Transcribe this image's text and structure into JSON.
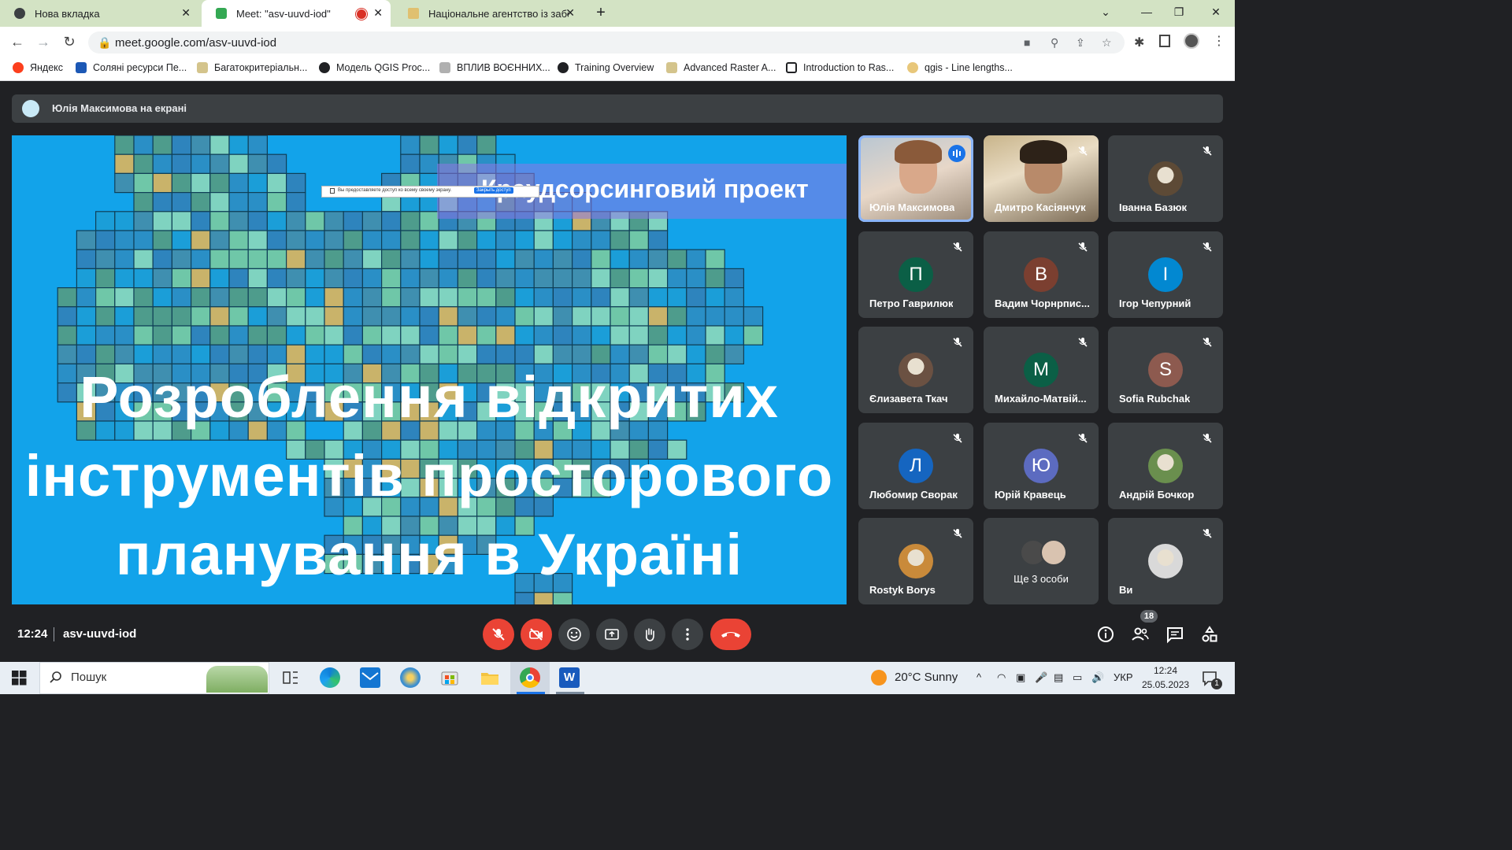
{
  "browser": {
    "tabs": [
      {
        "label": "Нова вкладка",
        "active": false
      },
      {
        "label": "Meet: \"asv-uuvd-iod\"",
        "active": true
      },
      {
        "label": "Національне агентство із забезп",
        "active": false
      }
    ],
    "url": "meet.google.com/asv-uuvd-iod",
    "bookmarks": [
      "Яндекс",
      "Соляні ресурси Пе...",
      "Багатокритеріальн...",
      "Модель QGIS Proc...",
      "ВПЛИВ ВОЄННИХ...",
      "Training Overview",
      "Advanced Raster A...",
      "Introduction to Ras...",
      "qgis - Line lengths..."
    ]
  },
  "meet": {
    "presenter_banner": "Юлія Максимова на екрані",
    "slide": {
      "subtitle": "Краудсорсинговий проект",
      "title_lines": [
        "Розроблення відкритих",
        "інструментів просторового",
        "планування в Україні"
      ],
      "share_popup_text": "Вы предоставляете доступ ко всему своему экрану.",
      "share_popup_button": "Закрыть доступ"
    },
    "participants": [
      {
        "name": "Юлія Максимова",
        "type": "video",
        "speaking": true
      },
      {
        "name": "Дмитро Касіянчук",
        "type": "video",
        "muted": true
      },
      {
        "name": "Іванна Базюк",
        "type": "photo",
        "muted": true,
        "color": "#5d4a36"
      },
      {
        "name": "Петро Гаврилюк",
        "initial": "П",
        "muted": true,
        "color": "#0b5f46"
      },
      {
        "name": "Вадим Чорнрпис...",
        "initial": "В",
        "muted": true,
        "color": "#7b3f30"
      },
      {
        "name": "Ігор Чепурний",
        "initial": "І",
        "muted": true,
        "color": "#0288d1"
      },
      {
        "name": "Єлизавета Ткач",
        "type": "photo",
        "muted": true,
        "color": "#6b5142"
      },
      {
        "name": "Михайло-Матвій...",
        "initial": "М",
        "muted": true,
        "color": "#0b5f46"
      },
      {
        "name": "Sofia Rubchak",
        "initial": "S",
        "muted": true,
        "color": "#8d5a4f"
      },
      {
        "name": "Любомир Сворак",
        "initial": "Л",
        "muted": true,
        "color": "#1565c0"
      },
      {
        "name": "Юрій Кравець",
        "initial": "Ю",
        "muted": true,
        "color": "#5c6bc0"
      },
      {
        "name": "Андрій Бочкор",
        "type": "photo",
        "muted": true,
        "color": "#6a8f4e"
      },
      {
        "name": "Rostyk Borys",
        "type": "photo",
        "muted": true,
        "color": "#c98a3a"
      },
      {
        "name": "Ще 3 особи",
        "type": "more"
      },
      {
        "name": "Ви",
        "type": "photo",
        "muted": true,
        "color": "#d9d9d9"
      }
    ],
    "time": "12:24",
    "meeting_code": "asv-uuvd-iod",
    "participant_count": "18"
  },
  "taskbar": {
    "search_placeholder": "Пошук",
    "weather": "20°C  Sunny",
    "language": "УКР",
    "time": "12:24",
    "date": "25.05.2023",
    "notifications": "1"
  },
  "colors": {
    "slide_bg": "#12a3ea",
    "end_call": "#ea4335",
    "tile_bg": "#3c4043",
    "meet_bg": "#202124"
  }
}
